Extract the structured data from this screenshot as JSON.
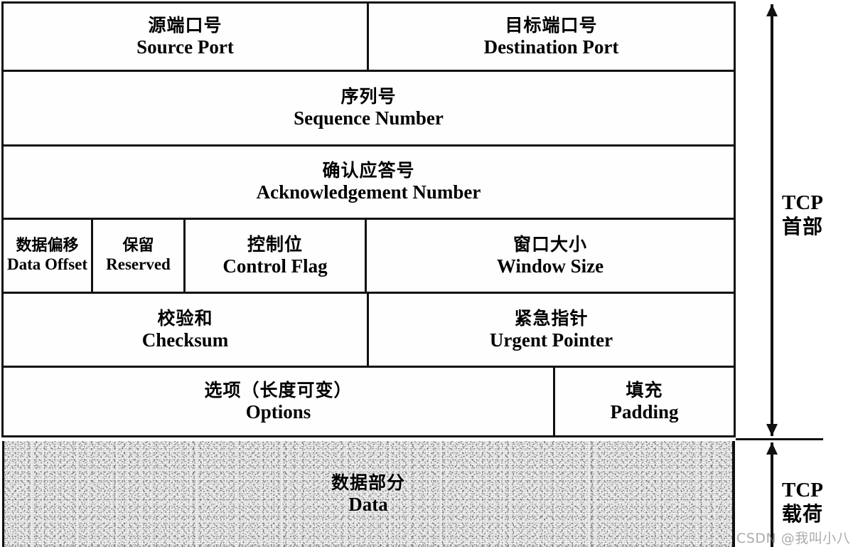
{
  "figure": {
    "title": "TCP Header Structure Diagram",
    "line_color": "#111111",
    "data_fill": "#f2f2f2"
  },
  "header_rows": [
    {
      "name": "ports",
      "cells": [
        {
          "cn": "源端口号",
          "en": "Source Port"
        },
        {
          "cn": "目标端口号",
          "en": "Destination Port"
        }
      ]
    },
    {
      "name": "sequence",
      "cells": [
        {
          "cn": "序列号",
          "en": "Sequence Number"
        }
      ]
    },
    {
      "name": "acknowledgement",
      "cells": [
        {
          "cn": "确认应答号",
          "en": "Acknowledgement Number"
        }
      ]
    },
    {
      "name": "control",
      "cells": [
        {
          "cn": "数据偏移",
          "en": "Data Offset"
        },
        {
          "cn": "保留",
          "en": "Reserved"
        },
        {
          "cn": "控制位",
          "en": "Control Flag"
        },
        {
          "cn": "窗口大小",
          "en": "Window Size"
        }
      ]
    },
    {
      "name": "checksum",
      "cells": [
        {
          "cn": "校验和",
          "en": "Checksum"
        },
        {
          "cn": "紧急指针",
          "en": "Urgent Pointer"
        }
      ]
    },
    {
      "name": "options",
      "cells": [
        {
          "cn": "选项（长度可变）",
          "en": "Options"
        },
        {
          "cn": "填充",
          "en": "Padding"
        }
      ]
    }
  ],
  "payload": {
    "cn": "数据部分",
    "en": "Data"
  },
  "side_labels": {
    "header": {
      "en": "TCP",
      "cn": "首部"
    },
    "payload": {
      "en": "TCP",
      "cn": "载荷"
    }
  },
  "watermark": "CSDN @我叫小八"
}
